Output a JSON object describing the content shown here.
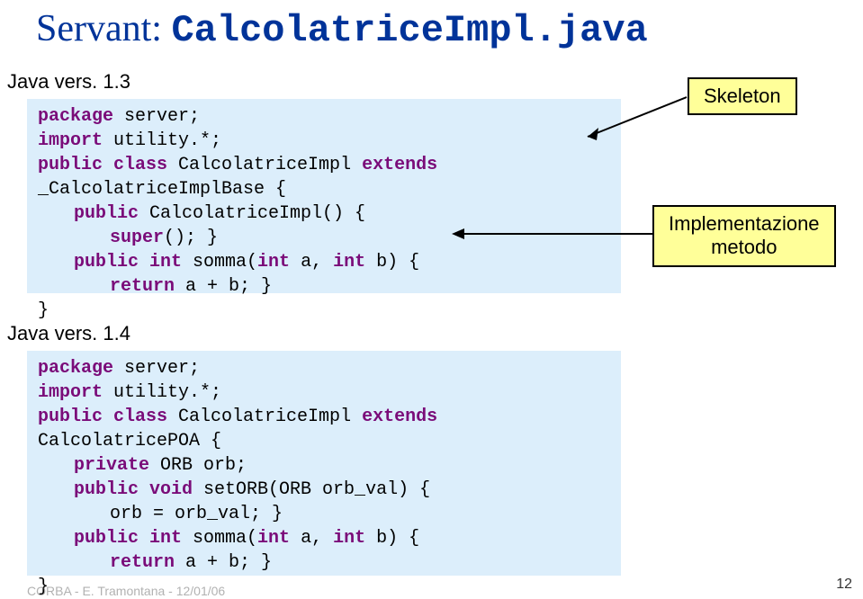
{
  "title": {
    "prefix": "Servant: ",
    "filename": "CalcolatriceImpl.java"
  },
  "versions": {
    "v1": "Java vers. 1.3",
    "v2": "Java vers. 1.4"
  },
  "code1": {
    "l1a": "package",
    "l1b": " server;",
    "l2a": "import",
    "l2b": " utility.*;",
    "l3a": "public class",
    "l3b": " CalcolatriceImpl ",
    "l3c": "extends",
    "l3d": " _CalcolatriceImplBase {",
    "l4a": "public",
    "l4b": " CalcolatriceImpl() {",
    "l5a": "super",
    "l5b": "(); }",
    "l6a": "public int",
    "l6b": " somma(",
    "l6c": "int",
    "l6d": " a, ",
    "l6e": "int",
    "l6f": " b) {",
    "l7a": "return",
    "l7b": " a + b; }",
    "l8": "}"
  },
  "code2": {
    "l1a": "package",
    "l1b": " server;",
    "l2a": "import",
    "l2b": " utility.*;",
    "l3a": "public class",
    "l3b": " CalcolatriceImpl ",
    "l3c": "extends",
    "l3d": " CalcolatricePOA {",
    "l4a": "private",
    "l4b": " ORB orb;",
    "l5a": "public void",
    "l5b": " setORB(ORB orb_val) {",
    "l6": "orb = orb_val; }",
    "l7a": "public int",
    "l7b": " somma(",
    "l7c": "int",
    "l7d": " a, ",
    "l7e": "int",
    "l7f": " b) {",
    "l8a": "return",
    "l8b": " a + b; }",
    "l9": "}"
  },
  "notes": {
    "skeleton": "Skeleton",
    "impl_line1": "Implementazione",
    "impl_line2": "metodo"
  },
  "footer": "CORBA - E. Tramontana - 12/01/06",
  "pagenum": "12"
}
